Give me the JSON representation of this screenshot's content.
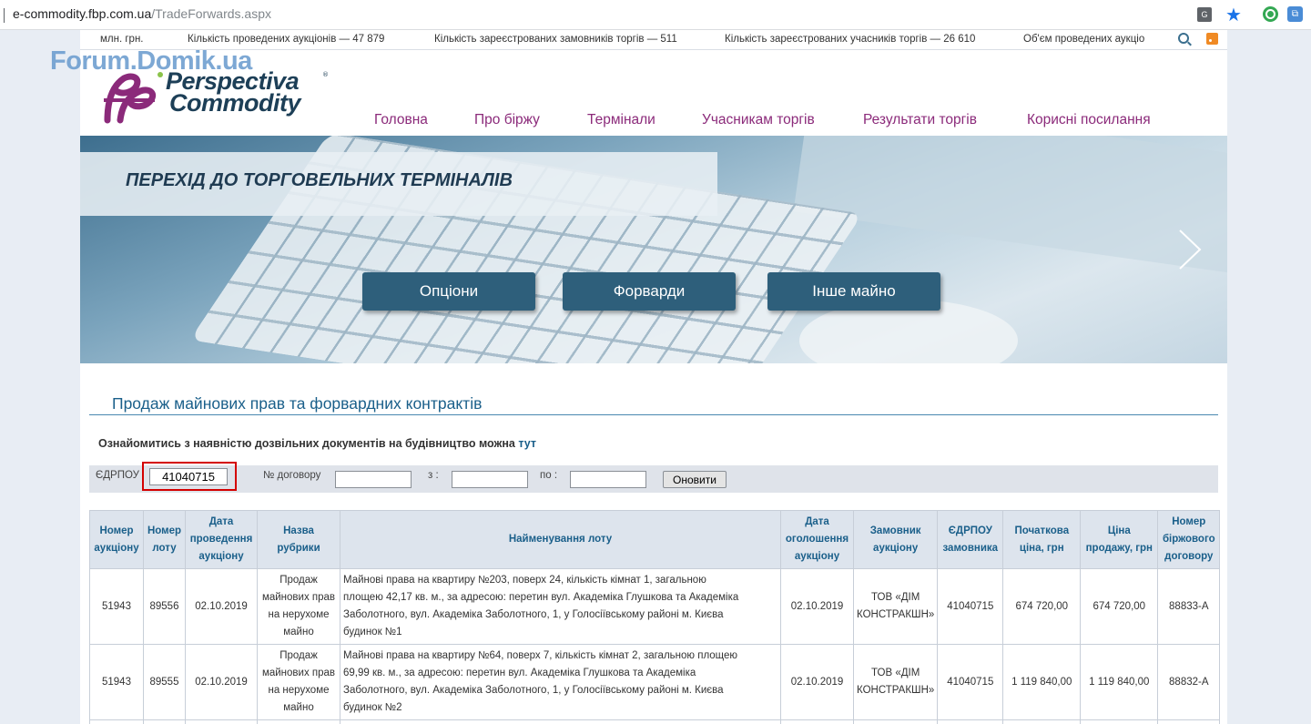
{
  "browser": {
    "url_host": "e-commodity.fbp.com.ua",
    "url_path": "/TradeForwards.aspx"
  },
  "stats": [
    "млн. грн.",
    "Кількість проведених аукціонів — 47 879",
    "Кількість зареєстрованих замовників торгів — 511",
    "Кількість зареєстрованих учасників торгів — 26 610",
    "Об'єм проведених аукціо"
  ],
  "watermark": "Forum.Domik.ua",
  "logo": {
    "line1": "Perspectiva",
    "line2": "Commodity",
    "tm": "®"
  },
  "nav": [
    "Головна",
    "Про біржу",
    "Термінали",
    "Учасникам торгів",
    "Результати торгів",
    "Корисні посилання"
  ],
  "banner": {
    "title": "ПЕРЕХІД ДО ТОРГОВЕЛЬНИХ ТЕРМІНАЛІВ",
    "buttons": [
      "Опціони",
      "Форварди",
      "Інше майно"
    ]
  },
  "section_title": "Продаж майнових прав та форвардних контрактів",
  "note": {
    "text": "Ознайомитись з наявністю дозвільних документів на будівництво можна ",
    "link": "тут"
  },
  "filter": {
    "edrpou_label": "ЄДРПОУ",
    "edrpou_value": "41040715",
    "contract_label": "№ договору",
    "from_label": "з :",
    "to_label": "по :",
    "refresh_label": "Оновити"
  },
  "table": {
    "headers": [
      [
        "Номер",
        "аукціону"
      ],
      [
        "Номер",
        "лоту"
      ],
      [
        "Дата",
        "проведення",
        "аукціону"
      ],
      [
        "Назва",
        "рубрики"
      ],
      [
        "Найменування лоту"
      ],
      [
        "Дата",
        "оголошення",
        "аукціону"
      ],
      [
        "Замовник",
        "аукціону"
      ],
      [
        "ЄДРПОУ",
        "замовника"
      ],
      [
        "Початкова",
        "ціна, грн"
      ],
      [
        "Ціна",
        "продажу, грн"
      ],
      [
        "Номер",
        "біржового",
        "договору"
      ]
    ],
    "rows": [
      {
        "auction": "51943",
        "lot": "89556",
        "date": "02.10.2019",
        "category": [
          "Продаж",
          "майнових прав",
          "на нерухоме",
          "майно"
        ],
        "name": [
          "Майнові права на квартиру №203, поверх 24, кількість кімнат 1, загальною",
          "площею 42,17 кв. м., за адресою: перетин вул. Академіка Глушкова та Академіка",
          "Заболотного, вул. Академіка Заболотного, 1, у Голосіївському районі м. Києва",
          "будинок №1"
        ],
        "announce": "02.10.2019",
        "customer": [
          "ТОВ «ДІМ",
          "КОНСТРАКШН»"
        ],
        "edrpou": "41040715",
        "start_price": "674 720,00",
        "sale_price": "674 720,00",
        "contract": "88833-А"
      },
      {
        "auction": "51943",
        "lot": "89555",
        "date": "02.10.2019",
        "category": [
          "Продаж",
          "майнових прав",
          "на нерухоме",
          "майно"
        ],
        "name": [
          "Майнові права на квартиру №64, поверх 7, кількість кімнат 2, загальною площею",
          "69,99 кв. м., за адресою: перетин вул. Академіка Глушкова та Академіка",
          "Заболотного, вул. Академіка Заболотного, 1, у Голосіївському районі м. Києва",
          "будинок №2"
        ],
        "announce": "02.10.2019",
        "customer": [
          "ТОВ «ДІМ",
          "КОНСТРАКШН»"
        ],
        "edrpou": "41040715",
        "start_price": "1 119 840,00",
        "sale_price": "1 119 840,00",
        "contract": "88832-А"
      }
    ]
  }
}
